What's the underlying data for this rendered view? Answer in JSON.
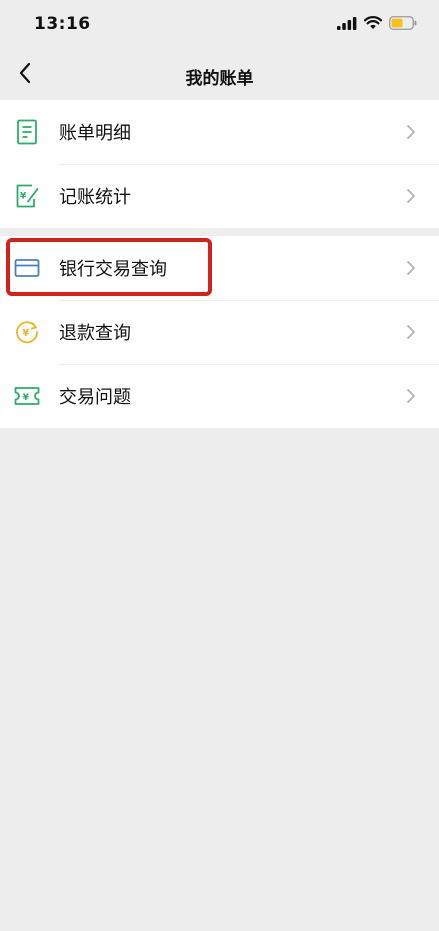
{
  "status_bar": {
    "time": "13:16",
    "battery_color": "#f4c21a"
  },
  "nav": {
    "title": "我的账单"
  },
  "groups": [
    {
      "items": [
        {
          "label": "账单明细",
          "icon": "bill-detail-icon",
          "icon_color": "#2aae67"
        },
        {
          "label": "记账统计",
          "icon": "accounting-stats-icon",
          "icon_color": "#2aae67"
        }
      ]
    },
    {
      "items": [
        {
          "label": "银行交易查询",
          "icon": "bank-card-icon",
          "icon_color": "#4b7fc4",
          "highlighted": true
        },
        {
          "label": "退款查询",
          "icon": "refund-icon",
          "icon_color": "#e9b723"
        },
        {
          "label": "交易问题",
          "icon": "transaction-issue-icon",
          "icon_color": "#2aae67"
        }
      ]
    }
  ],
  "highlight_color": "#d0231c"
}
